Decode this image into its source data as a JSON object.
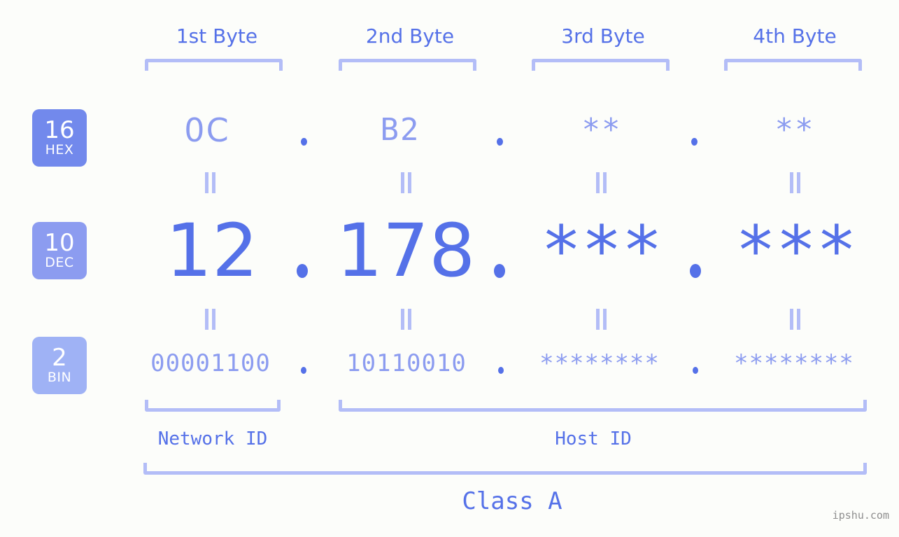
{
  "page": {
    "background_color": "#fcfdfa",
    "accent_strong": "#5571e8",
    "accent_light": "#8c9cf0",
    "accent_pale": "#b3bdf7",
    "watermark": "ipshu.com"
  },
  "byte_headers": [
    {
      "label": "1st Byte"
    },
    {
      "label": "2nd Byte"
    },
    {
      "label": "3rd Byte"
    },
    {
      "label": "4th Byte"
    }
  ],
  "bases": [
    {
      "number": "16",
      "name": "HEX",
      "color": "#7289ec"
    },
    {
      "number": "10",
      "name": "DEC",
      "color": "#8c9cf0"
    },
    {
      "number": "2",
      "name": "BIN",
      "color": "#9fb2f5"
    }
  ],
  "rows": {
    "hex": {
      "values": [
        "0C",
        "B2",
        "**",
        "**"
      ],
      "separator": "."
    },
    "dec": {
      "values": [
        "12",
        "178",
        "***",
        "***"
      ],
      "separator": "."
    },
    "bin": {
      "values": [
        "00001100",
        "10110010",
        "********",
        "********"
      ],
      "separator": "."
    }
  },
  "equals_symbol": "=",
  "sections": [
    {
      "label": "Network ID"
    },
    {
      "label": "Host ID"
    }
  ],
  "class": {
    "label": "Class A"
  }
}
